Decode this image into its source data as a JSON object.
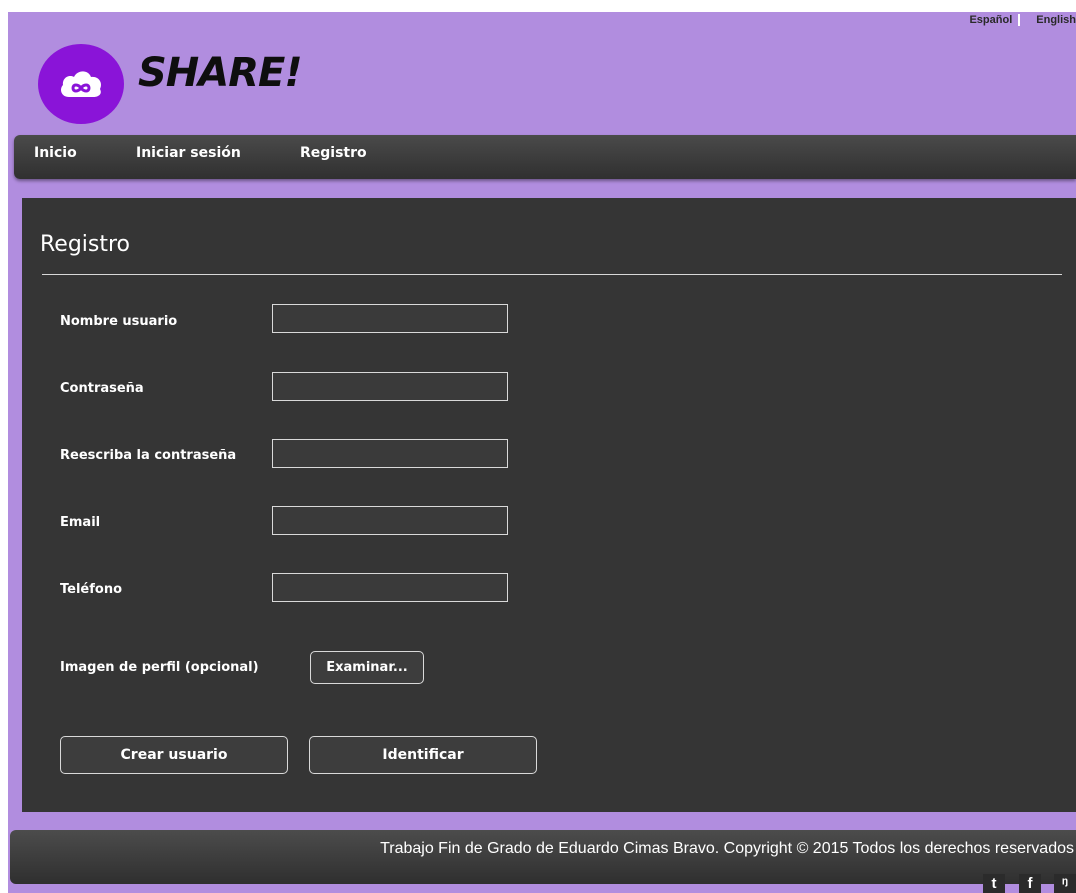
{
  "header": {
    "brand": "SHARE!",
    "languages": [
      "Español",
      "English"
    ]
  },
  "nav": {
    "items": [
      "Inicio",
      "Iniciar sesión",
      "Registro"
    ]
  },
  "form": {
    "title": "Registro",
    "fields": [
      {
        "label": "Nombre usuario",
        "value": ""
      },
      {
        "label": "Contraseña",
        "value": ""
      },
      {
        "label": "Reescriba la contraseña",
        "value": ""
      },
      {
        "label": "Email",
        "value": ""
      },
      {
        "label": "Teléfono",
        "value": ""
      }
    ],
    "image_label": "Imagen de perfil (opcional)",
    "browse_label": "Examinar...",
    "create_label": "Crear usuario",
    "login_label": "Identificar"
  },
  "footer": {
    "text": "Trabajo Fin de Grado de Eduardo Cimas Bravo. Copyright © 2015 Todos los derechos reservados"
  },
  "social": [
    {
      "icon": "twitter-icon",
      "glyph": "t"
    },
    {
      "icon": "facebook-icon",
      "glyph": "f"
    },
    {
      "icon": "rss-icon",
      "glyph": "ᵑ"
    }
  ],
  "colors": {
    "background": "#b18ddf",
    "logo": "#8a14d8",
    "panel": "#353535",
    "bar": "#3c3c3c"
  }
}
